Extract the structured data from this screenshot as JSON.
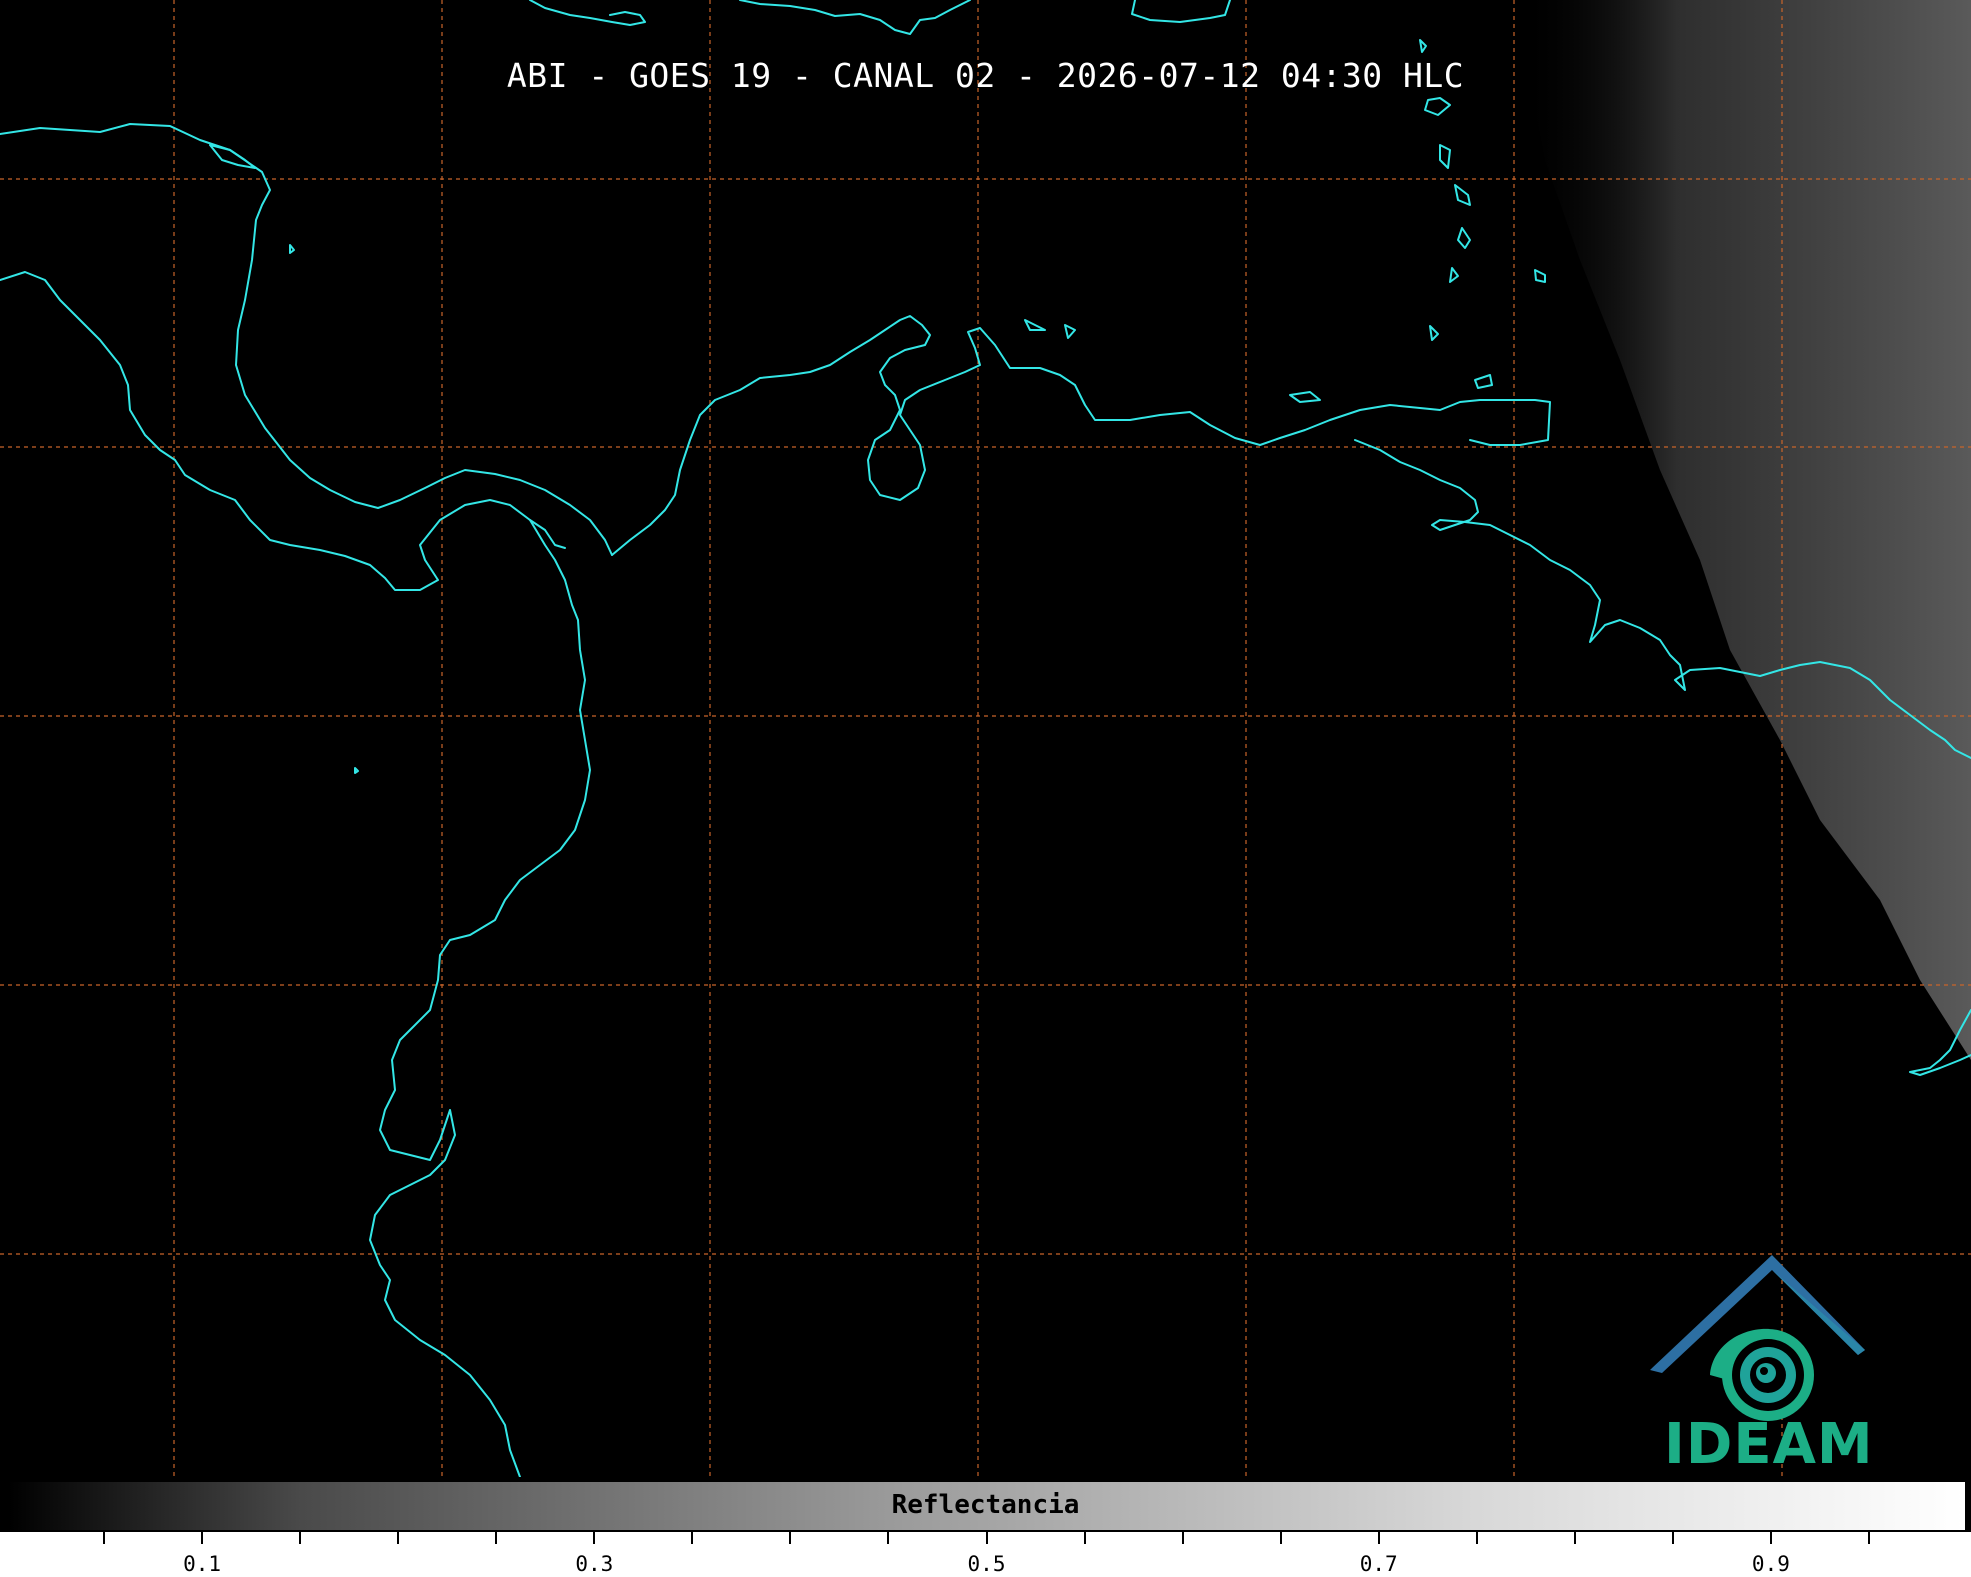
{
  "title": "ABI - GOES 19 - CANAL 02 - 2026-07-12 04:30 HLC",
  "logo": {
    "text": "IDEAM",
    "colors": {
      "roof": "#2d6fa3",
      "swirl": "#1cae86"
    }
  },
  "map": {
    "background_color": "#000000",
    "coastline_color": "#33e6e6",
    "grid_color": "#c8642a",
    "grid_style": "dashed"
  },
  "colorbar": {
    "label": "Reflectancia",
    "min": 0.0,
    "max": 1.0,
    "colormap": "grayscale",
    "tick_labels": [
      "0.1",
      "0.3",
      "0.5",
      "0.7",
      "0.9"
    ],
    "labeled_ticks": [
      0.1,
      0.3,
      0.5,
      0.7,
      0.9
    ],
    "minor_ticks": [
      0.05,
      0.15,
      0.2,
      0.25,
      0.35,
      0.4,
      0.45,
      0.55,
      0.6,
      0.65,
      0.75,
      0.8,
      0.85,
      0.95
    ]
  }
}
